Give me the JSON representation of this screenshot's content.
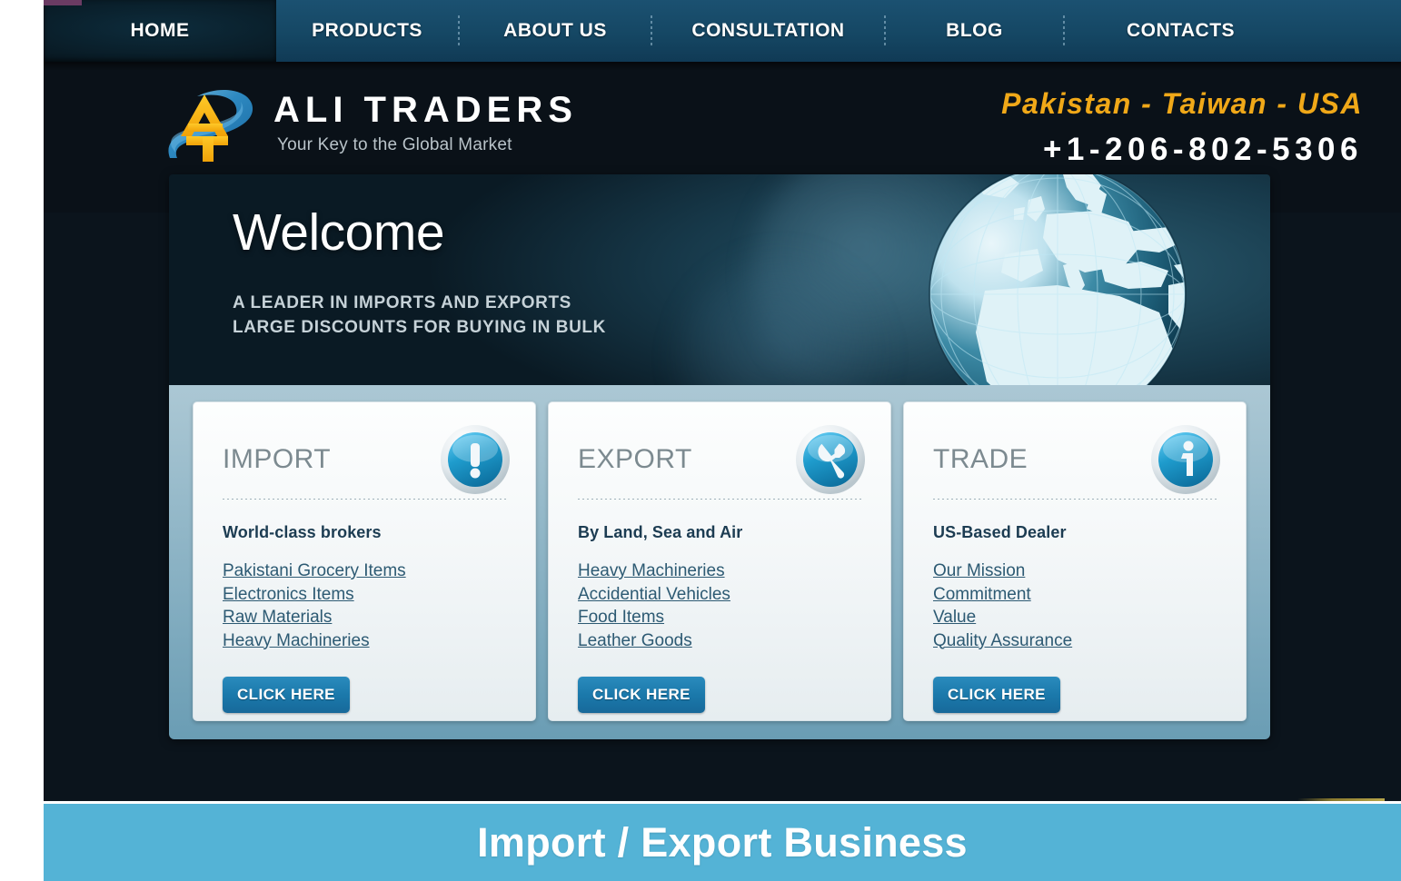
{
  "nav": {
    "items": [
      {
        "label": "HOME",
        "active": true
      },
      {
        "label": "PRODUCTS",
        "active": false
      },
      {
        "label": "ABOUT US",
        "active": false
      },
      {
        "label": "CONSULTATION",
        "active": false
      },
      {
        "label": "BLOG",
        "active": false
      },
      {
        "label": "CONTACTS",
        "active": false
      }
    ]
  },
  "header": {
    "brand_name": "ALI TRADERS",
    "tagline": "Your Key to the Global Market",
    "countries": "Pakistan - Taiwan - USA",
    "phone": "+1-206-802-5306",
    "logo_icon": "ali-traders-at-monogram"
  },
  "hero": {
    "title": "Welcome",
    "subtitle_line1": "A LEADER IN IMPORTS AND EXPORTS",
    "subtitle_line2": "LARGE DISCOUNTS FOR BUYING IN BULK",
    "image": "world-globe-europe-africa"
  },
  "cards": [
    {
      "title": "IMPORT",
      "icon": "exclamation-circle-icon",
      "lead": "World-class brokers",
      "links": [
        "Pakistani Grocery Items",
        "Electronics Items ",
        "Raw Materials",
        "Heavy Machineries"
      ],
      "button": "CLICK HERE"
    },
    {
      "title": "EXPORT",
      "icon": "wrench-circle-icon",
      "lead": "By Land, Sea and Air",
      "links": [
        "Heavy Machineries ",
        "Accidential Vehicles ",
        "Food Items ",
        "Leather Goods"
      ],
      "button": "CLICK HERE"
    },
    {
      "title": "TRADE",
      "icon": "info-circle-icon",
      "lead": "US-Based Dealer",
      "links": [
        "Our Mission ",
        "Commitment",
        "Value",
        "Quality Assurance"
      ],
      "button": "CLICK HERE"
    }
  ],
  "footer": {
    "caption": "Import / Export Business"
  },
  "colors": {
    "nav_bg": "#154764",
    "page_bg": "#0a1118",
    "accent_gold": "#f0a818",
    "link": "#2d5a73",
    "button": "#1b79ab",
    "footer_bg": "#54b3d6"
  }
}
